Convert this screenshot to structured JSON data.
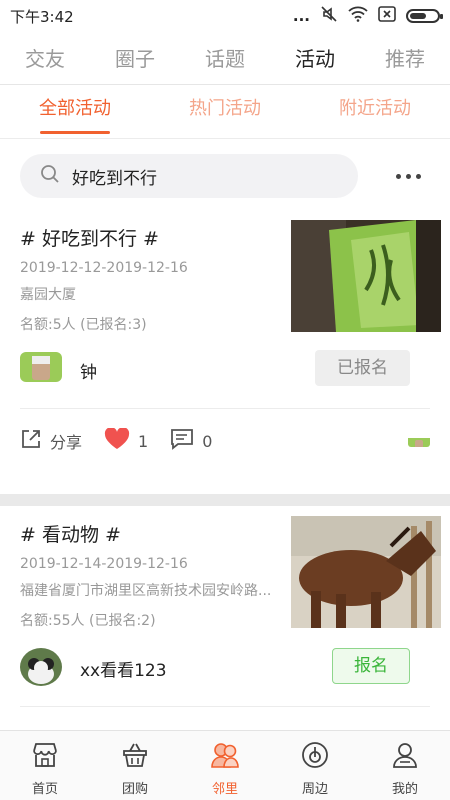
{
  "status_bar": {
    "time": "下午3:42",
    "dots": "...",
    "icons": [
      "mute-icon",
      "wifi-icon",
      "sim-icon",
      "battery-icon"
    ]
  },
  "top_tabs": [
    {
      "label": "交友",
      "active": false
    },
    {
      "label": "圈子",
      "active": false
    },
    {
      "label": "话题",
      "active": false
    },
    {
      "label": "活动",
      "active": true
    },
    {
      "label": "推荐",
      "active": false
    }
  ],
  "sub_tabs": [
    {
      "label": "全部活动",
      "active": true
    },
    {
      "label": "热门活动",
      "active": false
    },
    {
      "label": "附近活动",
      "active": false
    }
  ],
  "search": {
    "value": "好吃到不行",
    "icon": "search-icon"
  },
  "activities": [
    {
      "title": "# 好吃到不行 #",
      "date_range": "2019-12-12-2019-12-16",
      "location": "嘉园大厦",
      "quota": "名额:5人 (已报名:3)",
      "organizer": "钟",
      "button_label": "已报名",
      "share_label": "分享",
      "likes": "1",
      "comments": "0"
    },
    {
      "title": "# 看动物 #",
      "date_range": "2019-12-14-2019-12-16",
      "location": "福建省厦门市湖里区高新技术园安岭路...",
      "quota": "名额:55人 (已报名:2)",
      "organizer": "xx看看123",
      "button_label": "报名"
    }
  ],
  "bottom_nav": [
    {
      "label": "首页",
      "icon": "store-icon",
      "active": false
    },
    {
      "label": "团购",
      "icon": "basket-icon",
      "active": false
    },
    {
      "label": "邻里",
      "icon": "neighbors-icon",
      "active": true
    },
    {
      "label": "周边",
      "icon": "nearby-icon",
      "active": false
    },
    {
      "label": "我的",
      "icon": "profile-icon",
      "active": false
    }
  ],
  "colors": {
    "accent": "#f1612f",
    "accent_light": "#f4a58a",
    "join_green": "#3ab53a",
    "like_red": "#f0524f"
  }
}
